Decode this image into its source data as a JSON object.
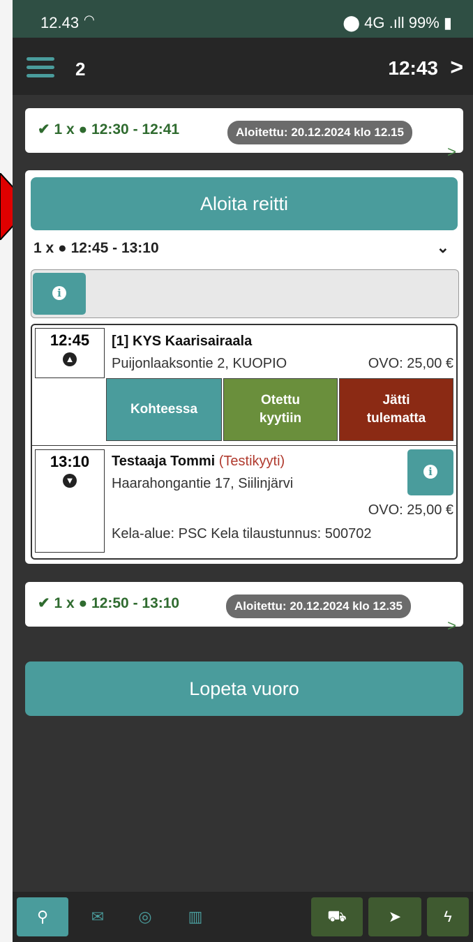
{
  "status_bar": {
    "time": "12.43",
    "signal_text": "4G .ıll 99%"
  },
  "app_bar": {
    "count": "2",
    "clock": "12:43",
    "next_icon": "chevron-right-icon"
  },
  "colors": {
    "teal": "#4a9c9c",
    "green": "#6a8f3c",
    "red": "#8b2a14",
    "status_bar": "#2f4f44"
  },
  "trip1": {
    "check": "✔",
    "qty": "1 x",
    "time_range": "12:30 - 12:41",
    "badge": "Aloitettu: 20.12.2024 klo 12.15"
  },
  "current": {
    "start_label": "Aloita reitti",
    "qty": "1 x",
    "time_range": "12:45 - 13:10",
    "stops": [
      {
        "time": "12:45",
        "title": "[1] KYS Kaarisairaala",
        "address": "Puijonlaaksontie 2, KUOPIO",
        "price": "OVO: 25,00 €"
      },
      {
        "time": "13:10",
        "title": "Testaaja Tommi",
        "title_note": "(Testikyyti)",
        "address": "Haarahongantie 17, Siilinjärvi",
        "price": "OVO: 25,00 €",
        "extra": "Kela-alue: PSC Kela tilaustunnus: 500702"
      }
    ],
    "actions": {
      "arrived": "Kohteessa",
      "picked_line1": "Otettu",
      "picked_line2": "kyytiin",
      "noshow_line1": "Jätti",
      "noshow_line2": "tulematta"
    }
  },
  "trip3": {
    "check": "✔",
    "qty": "1 x",
    "time_range": "12:50 - 13:10",
    "badge": "Aloitettu: 20.12.2024 klo 12.35"
  },
  "end_label": "Lopeta vuoro",
  "bottom_nav": [
    "route-icon",
    "mail-icon",
    "globe-icon",
    "map-icon",
    "car-icon",
    "navigate-icon",
    "bolt-icon"
  ]
}
